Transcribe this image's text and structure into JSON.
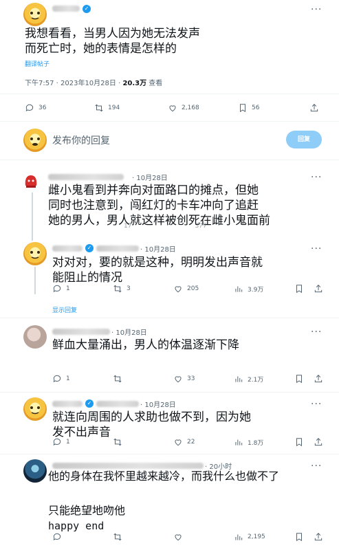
{
  "main_tweet": {
    "text_line1": "我想看看，当男人因为她无法发声",
    "text_line2": "而死亡时，她的表情是怎样的",
    "translate": "翻译帖子",
    "timestamp": "下午7:57 · 2023年10月28日 · ",
    "views_count": "20.3万",
    "views_label": " 查看",
    "stats": {
      "replies": "36",
      "retweets": "194",
      "likes": "2,168",
      "bookmarks": "56"
    }
  },
  "reply_box": {
    "placeholder": "发布你的回复",
    "button": "回复"
  },
  "replies": [
    {
      "date": "· 10月28日",
      "line1": "雌小鬼看到并奔向对面路口的摊点，但她",
      "line2": "同时也注意到，闯红灯的卡车冲向了追赶",
      "line3": "她的男人，男人就这样被创死在雌小鬼面前",
      "stats": {
        "replies": "1",
        "retweets": "17",
        "likes": "377",
        "views": ""
      }
    },
    {
      "date": "· 10月28日",
      "line1": "对对对，要的就是这种，明明发出声音就",
      "line2": "能阻止的情况",
      "stats": {
        "replies": "1",
        "retweets": "3",
        "likes": "205",
        "views": "3.9万"
      },
      "show_replies": "显示回复"
    },
    {
      "date": "· 10月28日",
      "line1": "鲜血大量涌出，男人的体温逐渐下降",
      "stats": {
        "replies": "1",
        "retweets": "",
        "likes": "33",
        "views": "2.1万"
      }
    },
    {
      "date": "· 10月28日",
      "line1": "就连向周围的人求助也做不到，因为她",
      "line2": "发不出声音",
      "stats": {
        "replies": "1",
        "retweets": "",
        "likes": "22",
        "views": "1.8万"
      }
    },
    {
      "date": "· 20小时",
      "line1": "他的身体在我怀里越来越冷，而我什么也做不了",
      "line2": "只能绝望地吻他",
      "line3": "happy  end",
      "stats": {
        "replies": "",
        "retweets": "",
        "likes": "",
        "views": "2,195"
      }
    }
  ],
  "icons": {
    "more": "more-dots-icon",
    "share": "share-icon"
  }
}
